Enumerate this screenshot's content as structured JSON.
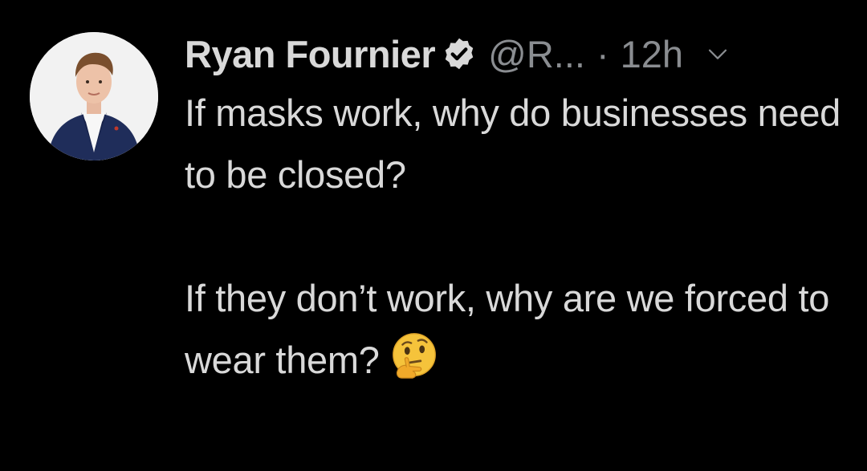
{
  "tweet": {
    "author": {
      "display_name": "Ryan Fournier",
      "handle": "@R...",
      "verified": true
    },
    "separator": "·",
    "timestamp": "12h",
    "text": {
      "paragraph_1": "If masks work, why do businesses need to be closed?",
      "paragraph_2": "If they don’t work, why are we forced to wear them?"
    },
    "emoji": "thinking-face",
    "icons": {
      "verified": "verified-badge-icon",
      "menu": "chevron-down-icon"
    }
  },
  "colors": {
    "background": "#000000",
    "primary_text": "#d9d9d9",
    "secondary_text": "#8a8d91"
  }
}
